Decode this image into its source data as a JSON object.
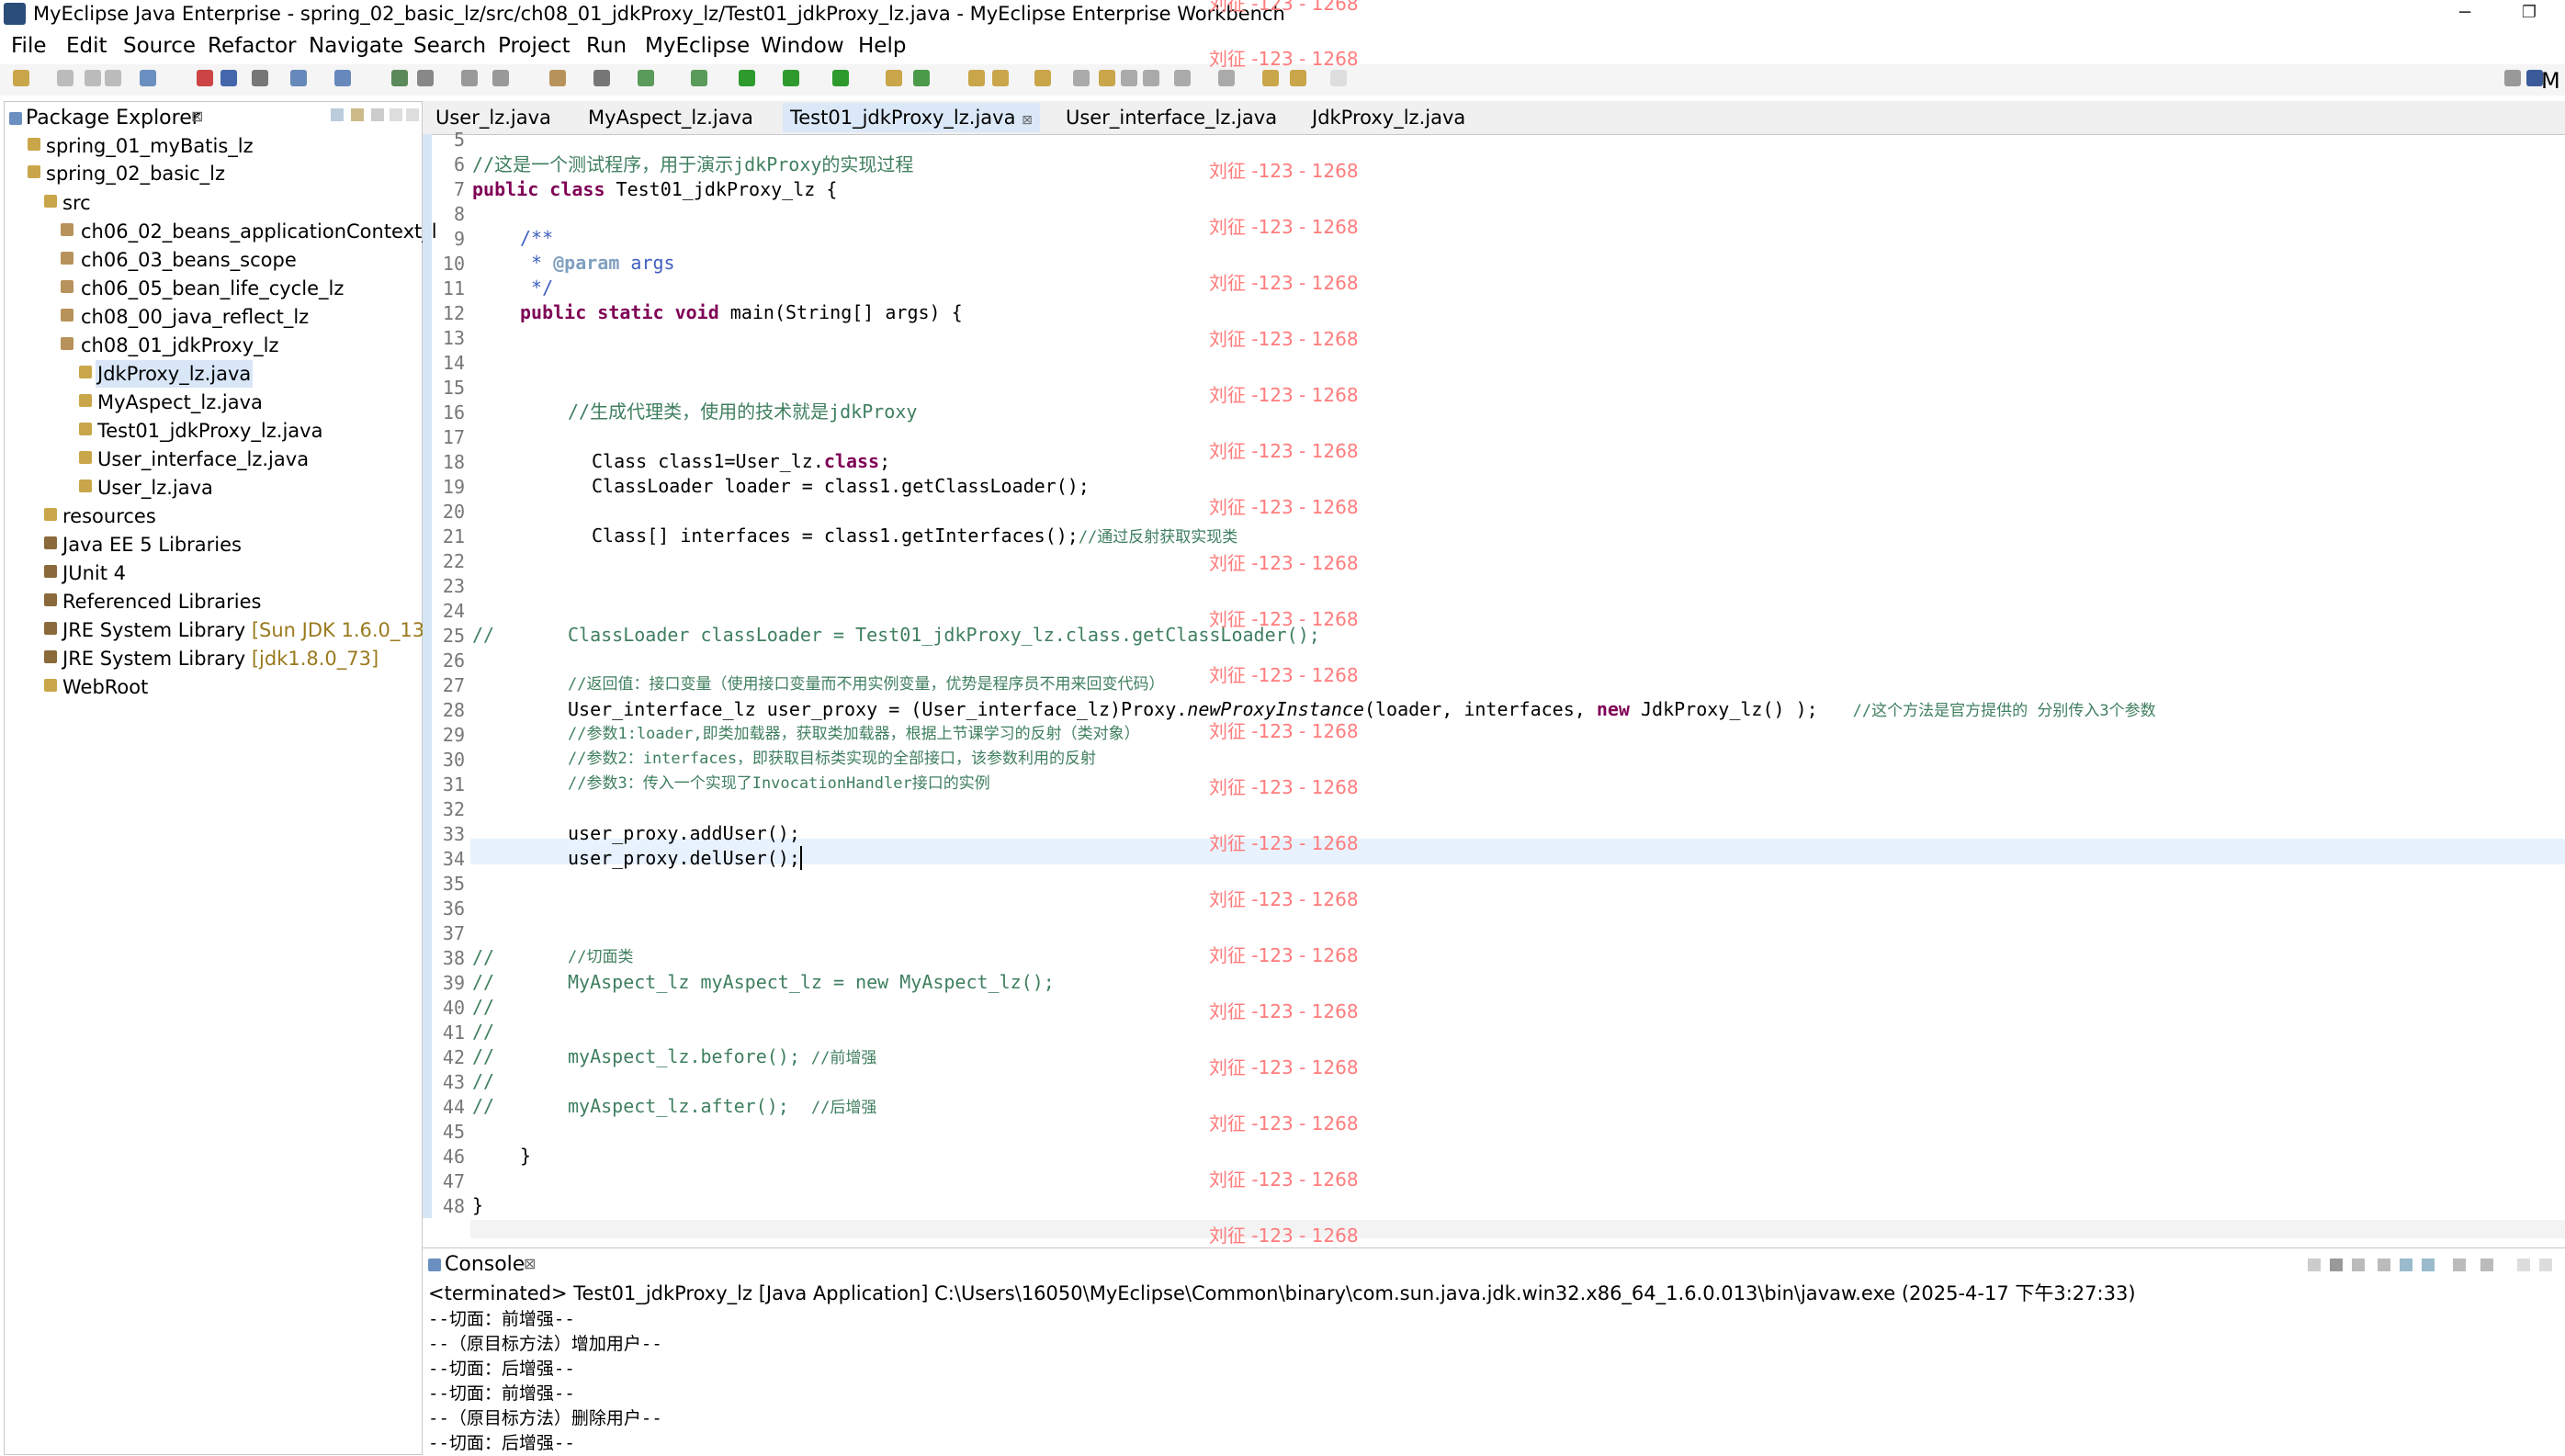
{
  "window": {
    "title": "MyEclipse Java Enterprise - spring_02_basic_lz/src/ch08_01_jdkProxy_lz/Test01_jdkProxy_lz.java - MyEclipse Enterprise Workbench",
    "min_glyph": "─",
    "max_glyph": "❐"
  },
  "menu": [
    "File",
    "Edit",
    "Source",
    "Refactor",
    "Navigate",
    "Search",
    "Project",
    "Run",
    "MyEclipse",
    "Window",
    "Help"
  ],
  "toolbar": {
    "perspective_label": "M"
  },
  "package_explorer": {
    "title": "Package Explorer",
    "close_glyph": "⊠",
    "items": [
      {
        "label": "spring_01_myBatis_lz",
        "extra": ""
      },
      {
        "label": "spring_02_basic_lz",
        "extra": ""
      },
      {
        "label": "src",
        "extra": ""
      },
      {
        "label": "ch06_02_beans_applicationContext_l",
        "extra": ""
      },
      {
        "label": "ch06_03_beans_scope",
        "extra": ""
      },
      {
        "label": "ch06_05_bean_life_cycle_lz",
        "extra": ""
      },
      {
        "label": "ch08_00_java_reflect_lz",
        "extra": ""
      },
      {
        "label": "ch08_01_jdkProxy_lz",
        "extra": ""
      },
      {
        "label": "JdkProxy_lz.java",
        "extra": ""
      },
      {
        "label": "MyAspect_lz.java",
        "extra": ""
      },
      {
        "label": "Test01_jdkProxy_lz.java",
        "extra": ""
      },
      {
        "label": "User_interface_lz.java",
        "extra": ""
      },
      {
        "label": "User_lz.java",
        "extra": ""
      },
      {
        "label": "resources",
        "extra": ""
      },
      {
        "label": "Java EE 5 Libraries",
        "extra": ""
      },
      {
        "label": "JUnit 4",
        "extra": ""
      },
      {
        "label": "Referenced Libraries",
        "extra": ""
      },
      {
        "label": "JRE System Library",
        "extra": "[Sun JDK 1.6.0_13]"
      },
      {
        "label": "JRE System Library",
        "extra": "[jdk1.8.0_73]"
      },
      {
        "label": "WebRoot",
        "extra": ""
      }
    ]
  },
  "editor": {
    "tabs": [
      "User_lz.java",
      "MyAspect_lz.java",
      "Test01_jdkProxy_lz.java",
      "User_interface_lz.java",
      "JdkProxy_lz.java"
    ],
    "tab_close_glyph": "⊠",
    "line_numbers": [
      "5",
      "6",
      "7",
      "8",
      "9",
      "10",
      "11",
      "12",
      "13",
      "14",
      "15",
      "16",
      "17",
      "18",
      "19",
      "20",
      "21",
      "22",
      "23",
      "24",
      "25",
      "26",
      "27",
      "28",
      "29",
      "30",
      "31",
      "32",
      "33",
      "34",
      "35",
      "36",
      "37",
      "38",
      "39",
      "40",
      "41",
      "42",
      "43",
      "44",
      "45",
      "46",
      "47",
      "48"
    ],
    "code": {
      "l6_comment": "//这是一个测试程序，用于演示jdkProxy的实现过程",
      "l7_kw": "public class",
      "l7_rest": " Test01_jdkProxy_lz {",
      "l9": "/**",
      "l10_star": " * ",
      "l10_tag": "@param",
      "l10_arg": " args",
      "l11": " */",
      "l12_kw": "public static void",
      "l12_rest": " main(String[] args) {",
      "l16_comment": "//生成代理类，使用的技术就是jdkProxy",
      "l18_a": "Class class1=User_lz.",
      "l18_kw": "class",
      "l18_b": ";",
      "l19": "ClassLoader loader = class1.getClassLoader();",
      "l21_code": "Class[] interfaces = class1.getInterfaces();",
      "l21_comment": "//通过反射获取实现类",
      "l25_prefix": "//",
      "l25_body": "ClassLoader classLoader = Test01_jdkProxy_lz.class.getClassLoader();",
      "l27_comment": "//返回值：接口变量（使用接口变量而不用实例变量，优势是程序员不用来回变代码）",
      "l28_a": "User_interface_lz user_proxy = (User_interface_lz)Proxy.",
      "l28_italic": "newProxyInstance",
      "l28_b": "(loader, interfaces, ",
      "l28_kw": "new",
      "l28_c": " JdkProxy_lz() );",
      "l28_comment": "//这个方法是官方提供的 分别传入3个参数",
      "l29_comment": "//参数1:loader,即类加载器，获取类加载器，根据上节课学习的反射（类对象）",
      "l30_comment": "//参数2：interfaces，即获取目标类实现的全部接口，该参数利用的反射",
      "l31_comment": "//参数3：传入一个实现了InvocationHandler接口的实例",
      "l33": "user_proxy.addUser();",
      "l34": "user_proxy.delUser();",
      "l38_prefix": "//",
      "l38_comment": "//切面类",
      "l39_prefix": "//",
      "l39_body": "MyAspect_lz myAspect_lz = new MyAspect_lz();",
      "l40_prefix": "//",
      "l41_prefix": "//",
      "l42_prefix": "//",
      "l42_body": "myAspect_lz.before(); ",
      "l42_comment": "//前增强",
      "l43_prefix": "//",
      "l44_prefix": "//",
      "l44_body": "myAspect_lz.after();  ",
      "l44_comment": "//后增强",
      "l46": "}",
      "l48": "}"
    }
  },
  "watermark": {
    "text": "刘征 -123 - 1268"
  },
  "console": {
    "title": "Console",
    "close_glyph": "⊠",
    "header": "<terminated> Test01_jdkProxy_lz [Java Application] C:\\Users\\16050\\MyEclipse\\Common\\binary\\com.sun.java.jdk.win32.x86_64_1.6.0.013\\bin\\javaw.exe (2025-4-17 下午3:27:33)",
    "lines": [
      "--切面：前增强--",
      "--（原目标方法）增加用户--",
      "--切面：后增强--",
      "--切面：前增强--",
      "--（原目标方法）删除用户--",
      "--切面：后增强--"
    ]
  },
  "colors": {
    "keyword": "#7f0055",
    "comment": "#3f7f5f",
    "javadoc": "#3f5fbf",
    "watermark": "#ff7b7b",
    "selection": "#d8e6f7",
    "current_line": "#e8f2fe"
  }
}
